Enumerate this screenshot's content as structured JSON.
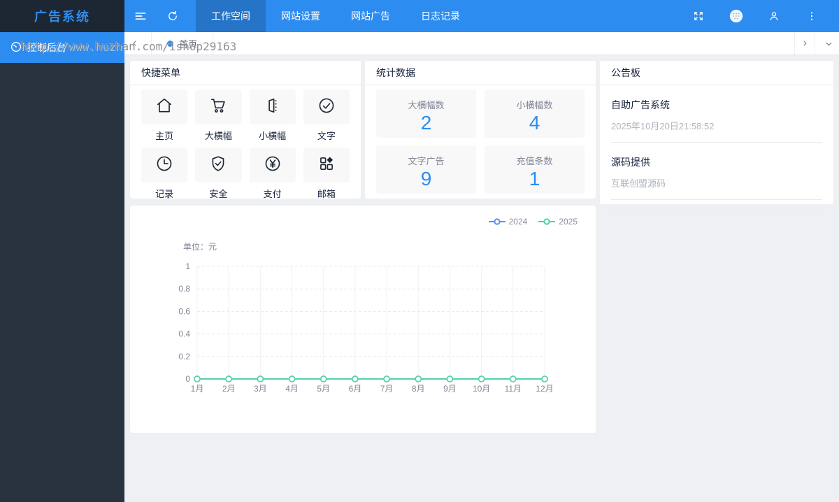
{
  "app": {
    "title": "广告系统"
  },
  "watermark": "http://www.huzhan.com/ishop29163",
  "sidebar": {
    "items": [
      {
        "label": "控制后台",
        "icon": "speedometer-icon",
        "active": true
      }
    ]
  },
  "navbar": {
    "left_icons": [
      "collapse-menu-icon",
      "refresh-icon"
    ],
    "menu": [
      {
        "label": "工作空间",
        "active": true
      },
      {
        "label": "网站设置",
        "active": false
      },
      {
        "label": "网站广告",
        "active": false
      },
      {
        "label": "日志记录",
        "active": false
      }
    ],
    "right_icons": [
      "fullscreen-icon",
      "avatar",
      "user-icon",
      "more-vertical-icon"
    ]
  },
  "tabbar": {
    "left_icon": "chevron-left-icon",
    "tabs": [
      {
        "label": "首页",
        "dot_color": "#2d8cf0",
        "active": true
      }
    ],
    "right_icons": [
      "chevron-right-icon",
      "chevron-down-icon"
    ]
  },
  "quick_menu": {
    "title": "快捷菜单",
    "items": [
      {
        "label": "主页",
        "icon": "home-icon"
      },
      {
        "label": "大横幅",
        "icon": "cart-icon"
      },
      {
        "label": "小横幅",
        "icon": "banner-door-icon"
      },
      {
        "label": "文字",
        "icon": "check-circle-icon"
      },
      {
        "label": "记录",
        "icon": "clock-icon"
      },
      {
        "label": "安全",
        "icon": "shield-check-icon"
      },
      {
        "label": "支付",
        "icon": "yen-circle-icon"
      },
      {
        "label": "邮箱",
        "icon": "apps-grid-icon"
      }
    ]
  },
  "stats": {
    "title": "统计数据",
    "cards": [
      {
        "label": "大横幅数",
        "value": "2"
      },
      {
        "label": "小横幅数",
        "value": "4"
      },
      {
        "label": "文字广告",
        "value": "9"
      },
      {
        "label": "充值条数",
        "value": "1"
      }
    ]
  },
  "notice": {
    "title": "公告板",
    "entries": [
      {
        "title": "自助广告系统",
        "subtitle": "2025年10月20日21:58:52"
      },
      {
        "title": "源码提供",
        "subtitle": "互联创盟源码"
      }
    ]
  },
  "chart_data": {
    "type": "line",
    "title": "",
    "unit_label": "单位：元",
    "categories": [
      "1月",
      "2月",
      "3月",
      "4月",
      "5月",
      "6月",
      "7月",
      "8月",
      "9月",
      "10月",
      "11月",
      "12月"
    ],
    "series": [
      {
        "name": "2024",
        "color": "#5B8FF9",
        "values": [
          0,
          0,
          0,
          0,
          0,
          0,
          0,
          0,
          0,
          0,
          0,
          0
        ]
      },
      {
        "name": "2025",
        "color": "#52D3A2",
        "values": [
          0,
          0,
          0,
          0,
          0,
          0,
          0,
          0,
          0,
          0,
          0,
          0
        ]
      }
    ],
    "xlabel": "",
    "ylabel": "",
    "ylim": [
      0,
      1
    ],
    "yticks": [
      0,
      0.2,
      0.4,
      0.6,
      0.8,
      1
    ],
    "grid": true,
    "legend_position": "top-right"
  },
  "colors": {
    "primary": "#2d8cf0",
    "sidebar_bg": "#293340",
    "logo_bg": "#1d2733",
    "content_bg": "#eef0f3",
    "stat_number": "#2d8cf0"
  }
}
